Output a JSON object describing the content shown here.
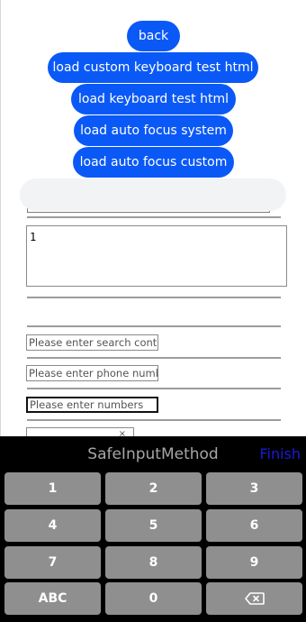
{
  "buttons": {
    "back": "back",
    "load_custom_keyboard": "load custom keyboard test html",
    "load_keyboard": "load keyboard test html",
    "load_auto_focus_system": "load auto focus system",
    "load_auto_focus_custom": "load auto focus custom"
  },
  "textarea": {
    "value": "1"
  },
  "fields": {
    "search_placeholder": "Please enter search content",
    "phone_placeholder": "Please enter phone number",
    "numbers_placeholder": "Please enter numbers",
    "partial_glyph": "×"
  },
  "keyboard": {
    "title": "SafeInputMethod",
    "finish": "Finish",
    "keys": [
      "1",
      "2",
      "3",
      "4",
      "5",
      "6",
      "7",
      "8",
      "9",
      "ABC",
      "0"
    ],
    "delete_icon": "backspace-icon"
  },
  "colors": {
    "accent": "#0a59f7",
    "keyboard_bg": "#000000",
    "key_bg": "#8f8f8f",
    "finish": "#1a1ad6"
  }
}
